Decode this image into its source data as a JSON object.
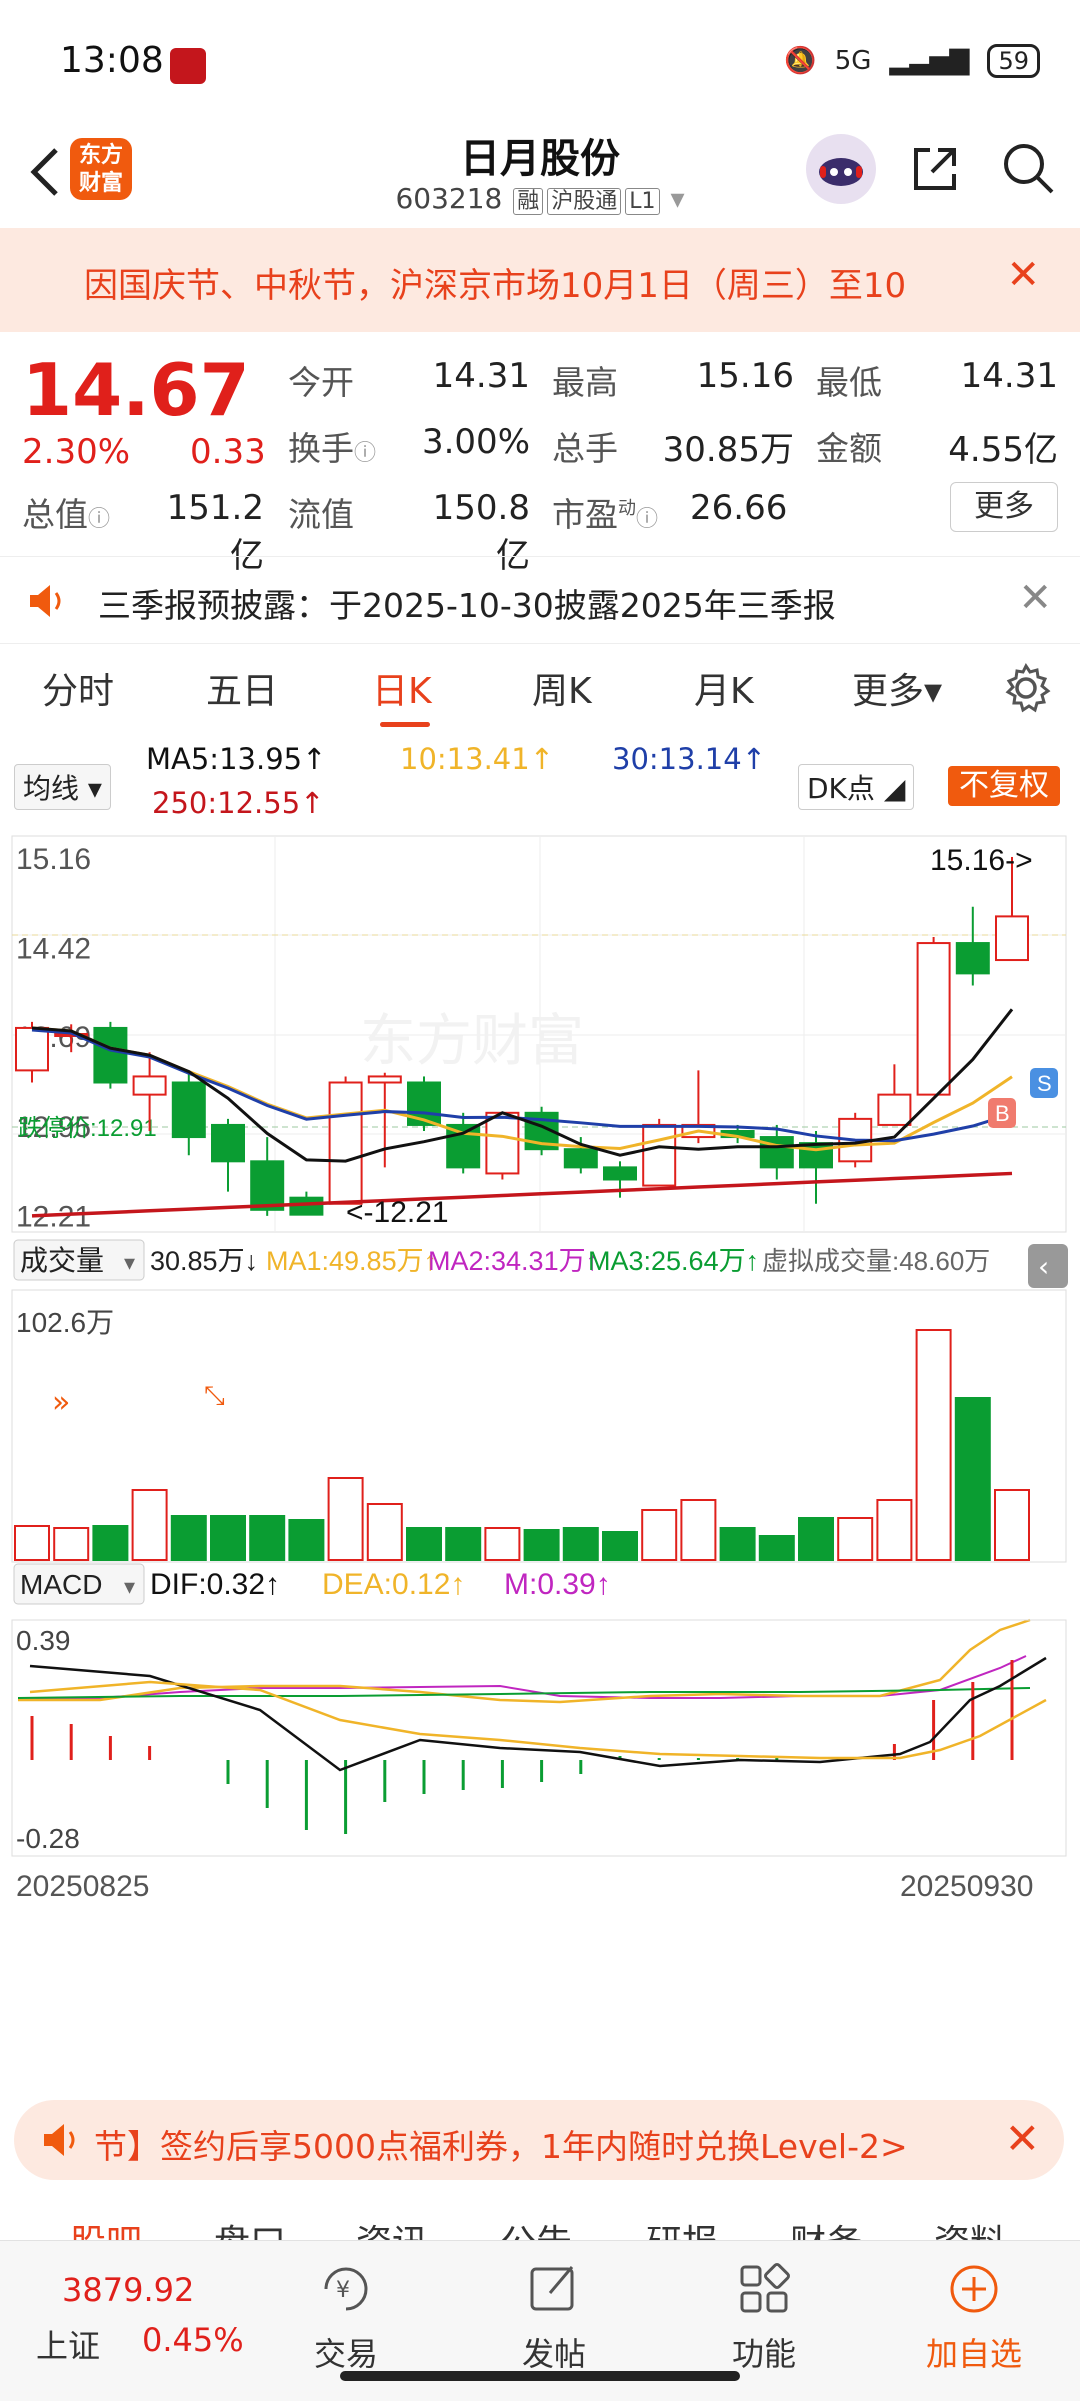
{
  "status": {
    "time": "13:08",
    "network": "5G",
    "battery": "59"
  },
  "header": {
    "title": "日月股份",
    "code": "603218",
    "tags": [
      "融",
      "沪股通",
      "L1"
    ],
    "logo": "东方财富"
  },
  "notice": {
    "text": "因国庆节、中秋节，沪深京市场10月1日（周三）至10"
  },
  "quote": {
    "price": "14.67",
    "change_pct": "2.30%",
    "change": "0.33",
    "open_label": "今开",
    "open": "14.31",
    "high_label": "最高",
    "high": "15.16",
    "low_label": "最低",
    "low": "14.31",
    "turnover_label": "换手",
    "turnover": "3.00%",
    "volume_label": "总手",
    "volume": "30.85万",
    "amount_label": "金额",
    "amount": "4.55亿",
    "mktcap_label": "总值",
    "mktcap": "151.2亿",
    "float_label": "流值",
    "float": "150.8亿",
    "pe_label": "市盈",
    "pe_sup": "动",
    "pe": "26.66",
    "more": "更多"
  },
  "announce": {
    "text": "三季报预披露：于2025-10-30披露2025年三季报"
  },
  "tabs": [
    "分时",
    "五日",
    "日K",
    "周K",
    "月K",
    "更多▾"
  ],
  "ma_bar": {
    "selector": "均线",
    "ma5": "MA5:13.95↑",
    "ma10": "10:13.41↑",
    "ma30": "30:13.14↑",
    "ma250": "250:12.55↑",
    "dk": "DK点",
    "fuquan": "不复权"
  },
  "kchart": {
    "price_labels": [
      "15.16",
      "14.42",
      "13.69",
      "12.95",
      "12.21"
    ],
    "high_marker": "15.16->",
    "low_marker": "<-12.21",
    "limit_down": "跌停价:12.91",
    "watermark": "东方财富",
    "buy_tag": "B",
    "sell_tag": "S"
  },
  "volume": {
    "selector": "成交量",
    "vol": "30.85万↓",
    "ma1": "MA1:49.85万↑",
    "ma2": "MA2:34.31万↑",
    "ma3": "MA3:25.64万↑",
    "virtual": "虚拟成交量:48.60万",
    "max_label": "102.6万"
  },
  "macd": {
    "selector": "MACD",
    "dif": "DIF:0.32↑",
    "dea": "DEA:0.12↑",
    "m": "M:0.39↑",
    "top_label": "0.39",
    "bottom_label": "-0.28"
  },
  "dates": {
    "start": "20250825",
    "end": "20250930"
  },
  "promo": {
    "text": "节】签约后享5000点福利券，1年内随时兑换Level-2>"
  },
  "subtabs": [
    "股吧",
    "盘口",
    "资讯",
    "公告",
    "研报",
    "财务",
    "资料"
  ],
  "index": {
    "value": "3879.92",
    "name": "上证",
    "pct": "0.45%"
  },
  "nav": {
    "trade": "交易",
    "post": "发帖",
    "func": "功能",
    "add": "加自选"
  },
  "colors": {
    "up": "#e0201b",
    "down": "#0a9d32",
    "brand": "#f05a0e",
    "ma5": "#111111",
    "ma10": "#f0b429",
    "ma30": "#1f3fa8",
    "ma250": "#c4161c"
  },
  "chart_data": {
    "type": "candlestick",
    "x": [
      "20250825",
      "20250930"
    ],
    "candles": [
      {
        "o": 13.4,
        "c": 13.75,
        "h": 13.8,
        "l": 13.3
      },
      {
        "o": 13.7,
        "c": 13.7,
        "h": 13.78,
        "l": 13.55
      },
      {
        "o": 13.75,
        "c": 13.3,
        "h": 13.8,
        "l": 13.25
      },
      {
        "o": 13.2,
        "c": 13.35,
        "h": 13.55,
        "l": 12.9
      },
      {
        "o": 13.3,
        "c": 12.85,
        "h": 13.4,
        "l": 12.7
      },
      {
        "o": 12.95,
        "c": 12.65,
        "h": 13.0,
        "l": 12.4
      },
      {
        "o": 12.65,
        "c": 12.25,
        "h": 12.85,
        "l": 12.2
      },
      {
        "o": 12.35,
        "c": 12.21,
        "h": 12.4,
        "l": 12.21
      },
      {
        "o": 12.3,
        "c": 13.3,
        "h": 13.35,
        "l": 12.3
      },
      {
        "o": 13.3,
        "c": 13.35,
        "h": 13.38,
        "l": 12.6
      },
      {
        "o": 13.3,
        "c": 12.95,
        "h": 13.35,
        "l": 12.9
      },
      {
        "o": 12.95,
        "c": 12.6,
        "h": 13.05,
        "l": 12.55
      },
      {
        "o": 12.55,
        "c": 13.05,
        "h": 13.05,
        "l": 12.5
      },
      {
        "o": 13.05,
        "c": 12.75,
        "h": 13.1,
        "l": 12.7
      },
      {
        "o": 12.75,
        "c": 12.6,
        "h": 12.85,
        "l": 12.55
      },
      {
        "o": 12.6,
        "c": 12.5,
        "h": 12.65,
        "l": 12.35
      },
      {
        "o": 12.45,
        "c": 12.95,
        "h": 13.0,
        "l": 12.45
      },
      {
        "o": 12.85,
        "c": 12.95,
        "h": 13.4,
        "l": 12.8
      },
      {
        "o": 12.9,
        "c": 12.85,
        "h": 12.95,
        "l": 12.8
      },
      {
        "o": 12.85,
        "c": 12.6,
        "h": 12.95,
        "l": 12.5
      },
      {
        "o": 12.8,
        "c": 12.6,
        "h": 12.9,
        "l": 12.3
      },
      {
        "o": 12.65,
        "c": 13.0,
        "h": 13.05,
        "l": 12.6
      },
      {
        "o": 12.95,
        "c": 13.2,
        "h": 13.45,
        "l": 12.95
      },
      {
        "o": 13.2,
        "c": 14.45,
        "h": 14.5,
        "l": 13.2
      },
      {
        "o": 14.45,
        "c": 14.2,
        "h": 14.75,
        "l": 14.1
      },
      {
        "o": 14.31,
        "c": 14.67,
        "h": 15.16,
        "l": 14.31
      }
    ],
    "volume_max": "102.6万",
    "macd_range": [
      -0.28,
      0.39
    ]
  }
}
